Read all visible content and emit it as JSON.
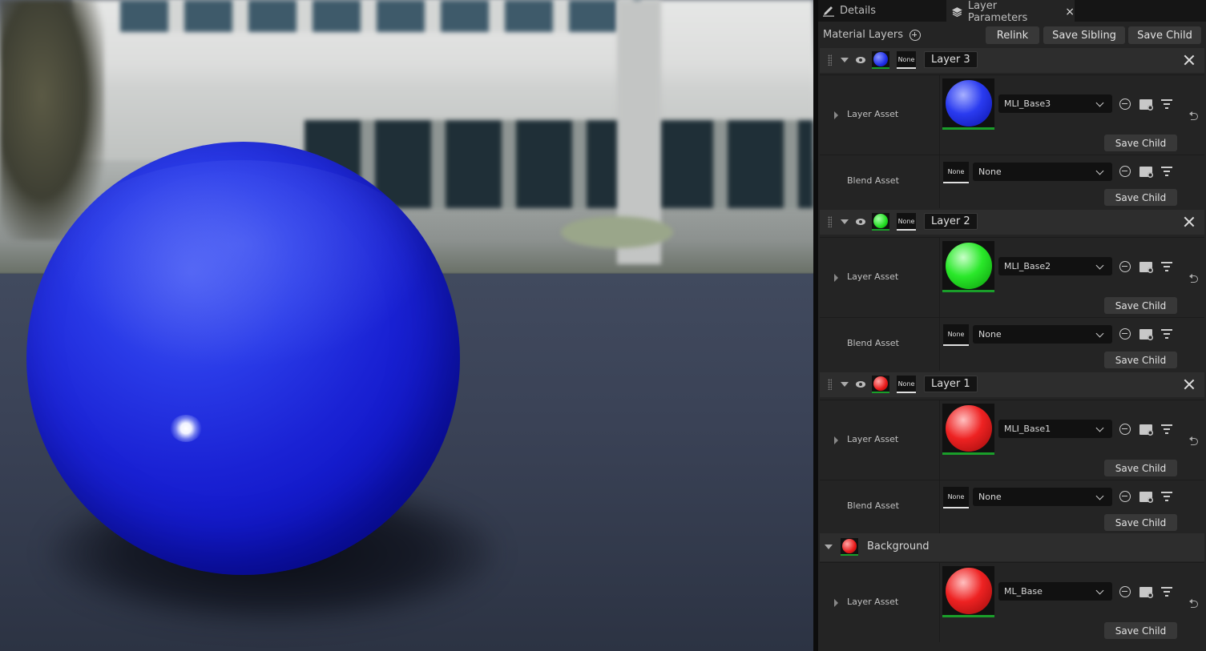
{
  "tabs": [
    {
      "label": "Details",
      "icon": "pencil-icon"
    },
    {
      "label": "Layer Parameters",
      "icon": "layers-icon",
      "close": "×"
    }
  ],
  "toolbar": {
    "title": "Material Layers",
    "relink": "Relink",
    "save_sibling": "Save Sibling",
    "save_child": "Save Child"
  },
  "layers": [
    {
      "name": "Layer 3",
      "color": "#1e2ee8",
      "none": "None",
      "layer_asset": {
        "label": "Layer Asset",
        "value": "MLI_Base3",
        "save": "Save Child"
      },
      "blend_asset": {
        "label": "Blend Asset",
        "thumb": "None",
        "value": "None",
        "save": "Save Child"
      }
    },
    {
      "name": "Layer 2",
      "color": "#22dd22",
      "none": "None",
      "layer_asset": {
        "label": "Layer Asset",
        "value": "MLI_Base2",
        "save": "Save Child"
      },
      "blend_asset": {
        "label": "Blend Asset",
        "thumb": "None",
        "value": "None",
        "save": "Save Child"
      }
    },
    {
      "name": "Layer 1",
      "color": "#e81818",
      "none": "None",
      "layer_asset": {
        "label": "Layer Asset",
        "value": "MLI_Base1",
        "save": "Save Child"
      },
      "blend_asset": {
        "label": "Blend Asset",
        "thumb": "None",
        "value": "None",
        "save": "Save Child"
      }
    }
  ],
  "background": {
    "title": "Background",
    "color": "#e81818",
    "layer_asset": {
      "label": "Layer Asset",
      "value": "ML_Base",
      "save": "Save Child"
    }
  }
}
